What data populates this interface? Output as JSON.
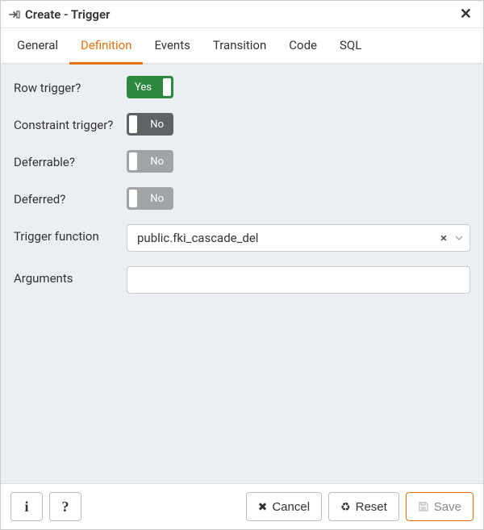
{
  "dialog": {
    "title": "Create - Trigger"
  },
  "tabs": [
    {
      "id": "general",
      "label": "General",
      "active": false
    },
    {
      "id": "definition",
      "label": "Definition",
      "active": true
    },
    {
      "id": "events",
      "label": "Events",
      "active": false
    },
    {
      "id": "transition",
      "label": "Transition",
      "active": false
    },
    {
      "id": "code",
      "label": "Code",
      "active": false
    },
    {
      "id": "sql",
      "label": "SQL",
      "active": false
    }
  ],
  "fields": {
    "row_trigger": {
      "label": "Row trigger?",
      "value": true,
      "on_text": "Yes",
      "off_text": "No",
      "enabled": true
    },
    "constraint_trigger": {
      "label": "Constraint trigger?",
      "value": false,
      "on_text": "Yes",
      "off_text": "No",
      "enabled": true
    },
    "deferrable": {
      "label": "Deferrable?",
      "value": false,
      "on_text": "Yes",
      "off_text": "No",
      "enabled": false
    },
    "deferred": {
      "label": "Deferred?",
      "value": false,
      "on_text": "Yes",
      "off_text": "No",
      "enabled": false
    },
    "trigger_function": {
      "label": "Trigger function",
      "value": "public.fki_cascade_del"
    },
    "arguments": {
      "label": "Arguments",
      "value": ""
    }
  },
  "footer": {
    "info_label": "i",
    "help_label": "?",
    "cancel": "Cancel",
    "reset": "Reset",
    "save": "Save"
  },
  "colors": {
    "accent": "#e8710a",
    "toggle_on": "#2b8a3e",
    "toggle_off": "#5f6368",
    "toggle_disabled": "#a0a4a8"
  }
}
